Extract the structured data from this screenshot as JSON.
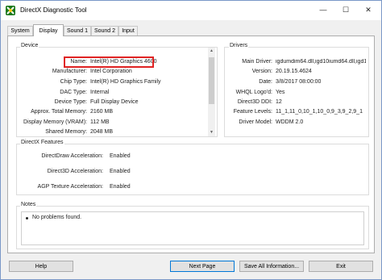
{
  "window": {
    "title": "DirectX Diagnostic Tool",
    "icon": "directx-app-icon"
  },
  "caption_buttons": {
    "minimize": "—",
    "maximize": "☐",
    "close": "✕"
  },
  "tabs": [
    {
      "label": "System",
      "active": false
    },
    {
      "label": "Display",
      "active": true
    },
    {
      "label": "Sound 1",
      "active": false
    },
    {
      "label": "Sound 2",
      "active": false
    },
    {
      "label": "Input",
      "active": false
    }
  ],
  "device": {
    "title": "Device",
    "rows": [
      {
        "label": "Name:",
        "value": "Intel(R) HD Graphics 4600"
      },
      {
        "label": "Manufacturer:",
        "value": "Intel Corporation"
      },
      {
        "label": "Chip Type:",
        "value": "Intel(R) HD Graphics Family"
      },
      {
        "label": "DAC Type:",
        "value": "Internal"
      },
      {
        "label": "Device Type:",
        "value": "Full Display Device"
      },
      {
        "label": "Approx. Total Memory:",
        "value": "2160 MB"
      },
      {
        "label": "Display Memory (VRAM):",
        "value": "112 MB"
      },
      {
        "label": "Shared Memory:",
        "value": "2048 MB"
      }
    ]
  },
  "drivers": {
    "title": "Drivers",
    "rows": [
      {
        "label": "Main Driver:",
        "value": "igdumdim64.dll,igd10iumd64.dll,igd10iu"
      },
      {
        "label": "Version:",
        "value": "20.19.15.4624"
      },
      {
        "label": "Date:",
        "value": "3/8/2017 08:00:00"
      },
      {
        "label": "WHQL Logo'd:",
        "value": "Yes"
      },
      {
        "label": "Direct3D DDI:",
        "value": "12"
      },
      {
        "label": "Feature Levels:",
        "value": "11_1,11_0,10_1,10_0,9_3,9_2,9_1"
      },
      {
        "label": "Driver Model:",
        "value": "WDDM 2.0"
      }
    ]
  },
  "directx_features": {
    "title": "DirectX Features",
    "rows": [
      {
        "label": "DirectDraw Acceleration:",
        "value": "Enabled"
      },
      {
        "label": "Direct3D Acceleration:",
        "value": "Enabled"
      },
      {
        "label": "AGP Texture Acceleration:",
        "value": "Enabled"
      }
    ]
  },
  "notes": {
    "title": "Notes",
    "items": [
      "No problems found."
    ]
  },
  "buttons": {
    "help": "Help",
    "next_page": "Next Page",
    "save_all": "Save All Information...",
    "exit": "Exit"
  },
  "colors": {
    "highlight": "#e02424",
    "accent": "#0078d7"
  }
}
